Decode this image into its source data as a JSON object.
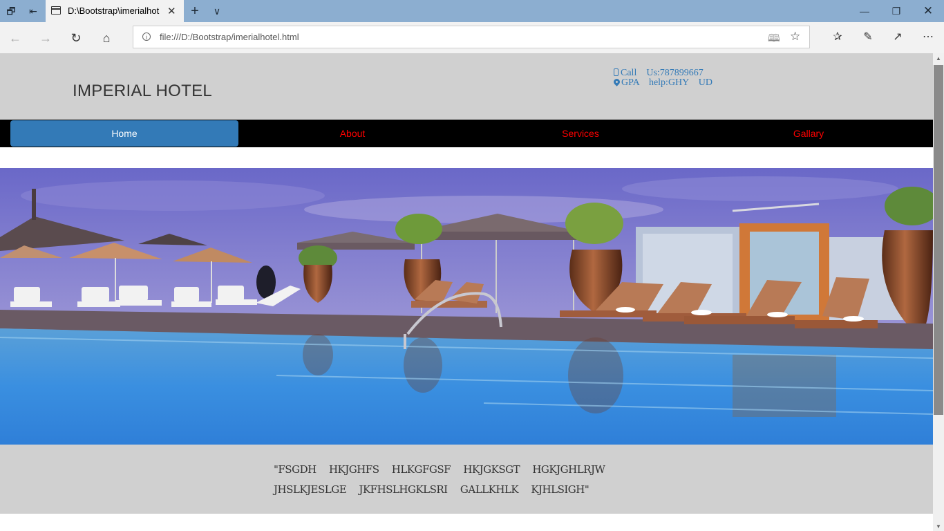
{
  "browser": {
    "tab_title": "D:\\Bootstrap\\imerialhot",
    "url": "file:///D:/Bootstrap/imerialhotel.html"
  },
  "site": {
    "brand": "IMPERIAL HOTEL",
    "contact": {
      "call": "Call    Us:787899667",
      "address": "GPA    help:GHY    UD"
    },
    "nav": [
      {
        "label": "Home",
        "active": true
      },
      {
        "label": "About",
        "active": false
      },
      {
        "label": "Services",
        "active": false
      },
      {
        "label": "Gallary",
        "active": false
      }
    ],
    "footer_text": "\"FSGDH HKJGHFS HLKGFGSF HKJGKSGT HGKJGHLRJW JHSLKJESLGE JKFHSLHGKLSRI GALLKHLK KJHLSIGH\""
  },
  "colors": {
    "nav_bg": "#000000",
    "nav_link": "#ff0000",
    "nav_active": "#337ab7",
    "header_bg": "#d0d0d0",
    "contact": "#337ab7"
  }
}
